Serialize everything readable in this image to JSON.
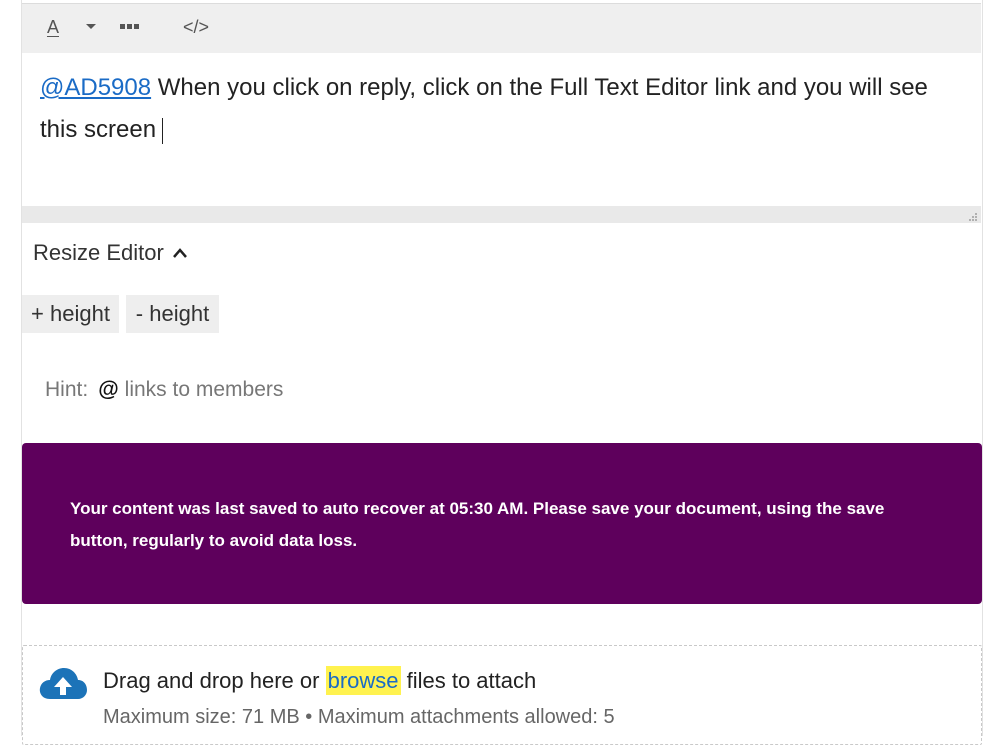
{
  "toolbar": {
    "font_color_letter": "A",
    "font_color_icon": "font-color-icon",
    "dropdown_icon": "caret-down-icon",
    "more_icon": "more-options-icon",
    "code_label": "</>"
  },
  "editor": {
    "mention": "@AD5908",
    "body_text": " When you click on reply, click on the Full Text Editor link and you will see this screen"
  },
  "resize": {
    "label": "Resize Editor",
    "plus_height": "+ height",
    "minus_height": "- height"
  },
  "hint": {
    "label": "Hint:",
    "symbol": "@",
    "text": "links to members"
  },
  "banner": {
    "message": "Your content was last saved to auto recover at 05:30 AM. Please save your document, using the save button, regularly to avoid data loss.",
    "color": "#5e005c"
  },
  "attachments": {
    "prefix": "Drag and drop here or ",
    "browse_label": "browse",
    "suffix": " files to attach",
    "limits": "Maximum size: 71 MB • Maximum attachments allowed: 5",
    "icon": "cloud-upload-icon",
    "icon_color": "#1c73b8"
  }
}
